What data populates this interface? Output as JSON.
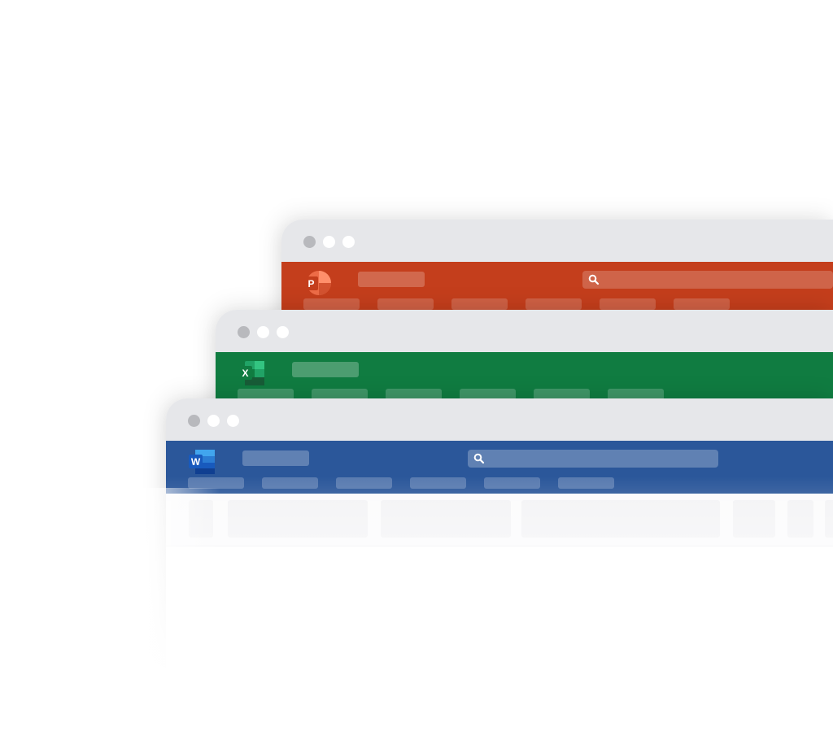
{
  "windows": {
    "powerpoint": {
      "logo_letter": "P",
      "ribbon_color": "#c43e1c",
      "icon": "powerpoint-logo-icon",
      "tab_count": 6
    },
    "excel": {
      "logo_letter": "X",
      "ribbon_color": "#107c41",
      "icon": "excel-logo-icon",
      "tab_count": 6
    },
    "word": {
      "logo_letter": "W",
      "ribbon_color": "#2b579a",
      "icon": "word-logo-icon",
      "tab_count": 6
    }
  },
  "titlebar": {
    "color": "#e6e7ea",
    "dot_colors": [
      "#b8b9bd",
      "#ffffff",
      "#ffffff"
    ]
  },
  "search_icon": "search-icon"
}
